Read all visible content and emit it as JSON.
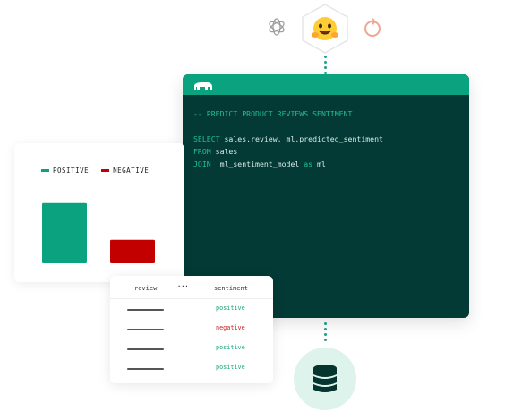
{
  "providers": [
    {
      "icon": "openai-icon"
    },
    {
      "icon": "hugging-face-icon"
    },
    {
      "icon": "ring-icon"
    }
  ],
  "code": {
    "comment": "-- PREDICT PRODUCT REVIEWS SENTIMENT",
    "lines": [
      {
        "kw": "SELECT",
        "rest": " sales.review, ml.predicted_sentiment"
      },
      {
        "kw": "FROM",
        "rest": " sales"
      },
      {
        "kw": "JOIN",
        "rest": "  ml_sentiment_model ",
        "kw2": "as",
        "rest2": " ml"
      }
    ]
  },
  "chart": {
    "legend": [
      "POSITIVE",
      "NEGATIVE"
    ],
    "colors": {
      "positive": "#0aa27f",
      "negative": "#c30000"
    }
  },
  "chart_data": {
    "type": "bar",
    "categories": [
      "POSITIVE",
      "NEGATIVE"
    ],
    "values": [
      82,
      32
    ],
    "ylim": [
      0,
      100
    ],
    "title": "",
    "xlabel": "",
    "ylabel": "",
    "grid": false,
    "legend": "top-left"
  },
  "table": {
    "headers": {
      "review": "review",
      "ellipsis": "···",
      "sentiment": "sentiment"
    },
    "rows": [
      {
        "sentiment": "positive",
        "color": "#1aa57f"
      },
      {
        "sentiment": "negative",
        "color": "#c71f1f"
      },
      {
        "sentiment": "positive",
        "color": "#1aa57f"
      },
      {
        "sentiment": "positive",
        "color": "#1aa57f"
      }
    ]
  },
  "database": {
    "icon": "database-icon"
  }
}
